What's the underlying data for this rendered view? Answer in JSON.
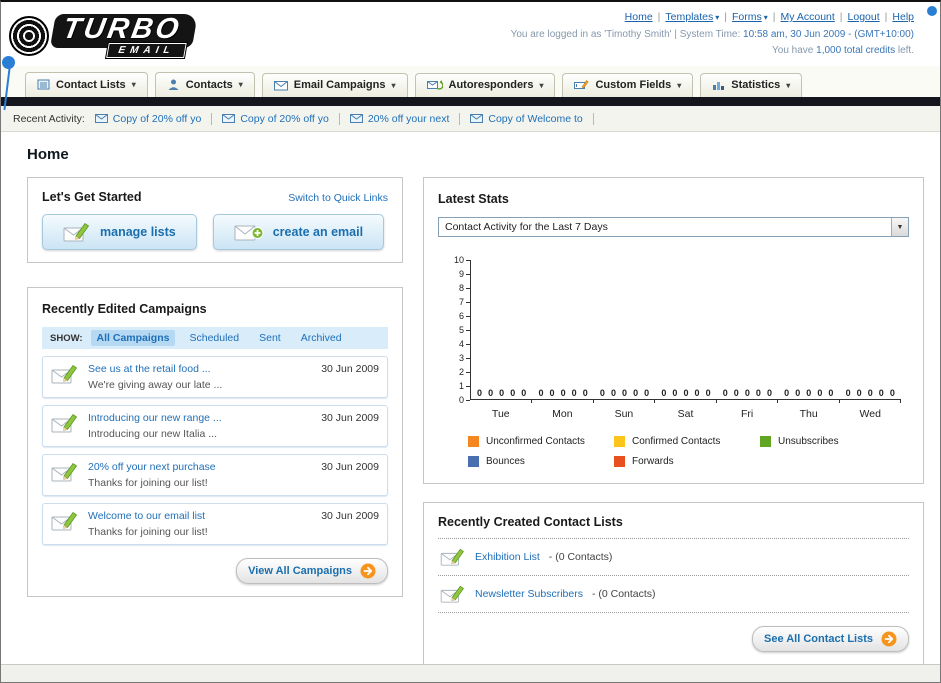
{
  "icons": {
    "chevron_down": "▾",
    "select_caret": "▼",
    "pipe": "|"
  },
  "header": {
    "logo": {
      "title": "TURBO",
      "subtitle": "EMAIL"
    },
    "nav": [
      {
        "label": "Home"
      },
      {
        "label": "Templates"
      },
      {
        "label": "Forms"
      },
      {
        "label": "My Account"
      },
      {
        "label": "Logout"
      },
      {
        "label": "Help"
      }
    ],
    "login_prefix": "You are logged in as 'Timothy Smith' | System Time:",
    "login_time": "10:58 am, 30 Jun 2009",
    "login_tz": "- (GMT+10:00)",
    "credits_prefix": "You have",
    "credits_value": "1,000 total credits",
    "credits_suffix": "left."
  },
  "main_nav": {
    "tabs": [
      {
        "label": "Contact Lists"
      },
      {
        "label": "Contacts"
      },
      {
        "label": "Email Campaigns"
      },
      {
        "label": "Autoresponders"
      },
      {
        "label": "Custom Fields"
      },
      {
        "label": "Statistics"
      }
    ]
  },
  "activity": {
    "label": "Recent Activity:",
    "items": [
      "Copy of 20% off yo",
      "Copy of 20% off yo",
      "20% off your next",
      "Copy of Welcome to"
    ]
  },
  "page_title": "Home",
  "get_started": {
    "title": "Let's Get Started",
    "switch_link": "Switch to Quick Links",
    "manage_lists_label": "manage lists",
    "create_email_label": "create an email"
  },
  "campaigns": {
    "title": "Recently Edited Campaigns",
    "show_label": "SHOW:",
    "tabs": [
      {
        "label": "All Campaigns",
        "active": true
      },
      {
        "label": "Scheduled",
        "active": false
      },
      {
        "label": "Sent",
        "active": false
      },
      {
        "label": "Archived",
        "active": false
      }
    ],
    "items": [
      {
        "title": "See us at the retail food ...",
        "subtitle": "We're giving away our late ...",
        "date": "30 Jun 2009"
      },
      {
        "title": "Introducing our new range ...",
        "subtitle": "Introducing our new Italia ...",
        "date": "30 Jun 2009"
      },
      {
        "title": "20% off your next purchase",
        "subtitle": "Thanks for joining our list!",
        "date": "30 Jun 2009"
      },
      {
        "title": "Welcome to our email list",
        "subtitle": "Thanks for joining our list!",
        "date": "30 Jun 2009"
      }
    ],
    "view_all_label": "View All Campaigns"
  },
  "stats": {
    "title": "Latest Stats",
    "period_selected": "Contact Activity for the Last 7 Days",
    "chart_data": {
      "type": "bar",
      "title": "Contact Activity for the Last 7 Days",
      "xlabel": "",
      "ylabel": "",
      "ylim": [
        0,
        10
      ],
      "ytick_step": 1,
      "grid": false,
      "legend_position": "bottom",
      "categories": [
        "Tue",
        "Mon",
        "Sun",
        "Sat",
        "Fri",
        "Thu",
        "Wed"
      ],
      "series": [
        {
          "name": "Unconfirmed Contacts",
          "color": "#f6861f",
          "values": [
            0,
            0,
            0,
            0,
            0,
            0,
            0
          ]
        },
        {
          "name": "Confirmed Contacts",
          "color": "#fdc51c",
          "values": [
            0,
            0,
            0,
            0,
            0,
            0,
            0
          ]
        },
        {
          "name": "Unsubscribes",
          "color": "#61a623",
          "values": [
            0,
            0,
            0,
            0,
            0,
            0,
            0
          ]
        },
        {
          "name": "Bounces",
          "color": "#4a6fb0",
          "values": [
            0,
            0,
            0,
            0,
            0,
            0,
            0
          ]
        },
        {
          "name": "Forwards",
          "color": "#e8501d",
          "values": [
            0,
            0,
            0,
            0,
            0,
            0,
            0
          ]
        }
      ]
    }
  },
  "contact_lists": {
    "title": "Recently Created Contact Lists",
    "items": [
      {
        "name": "Exhibition List",
        "detail": "- (0 Contacts)"
      },
      {
        "name": "Newsletter Subscribers",
        "detail": "- (0 Contacts)"
      }
    ],
    "see_all_label": "See All Contact Lists"
  }
}
